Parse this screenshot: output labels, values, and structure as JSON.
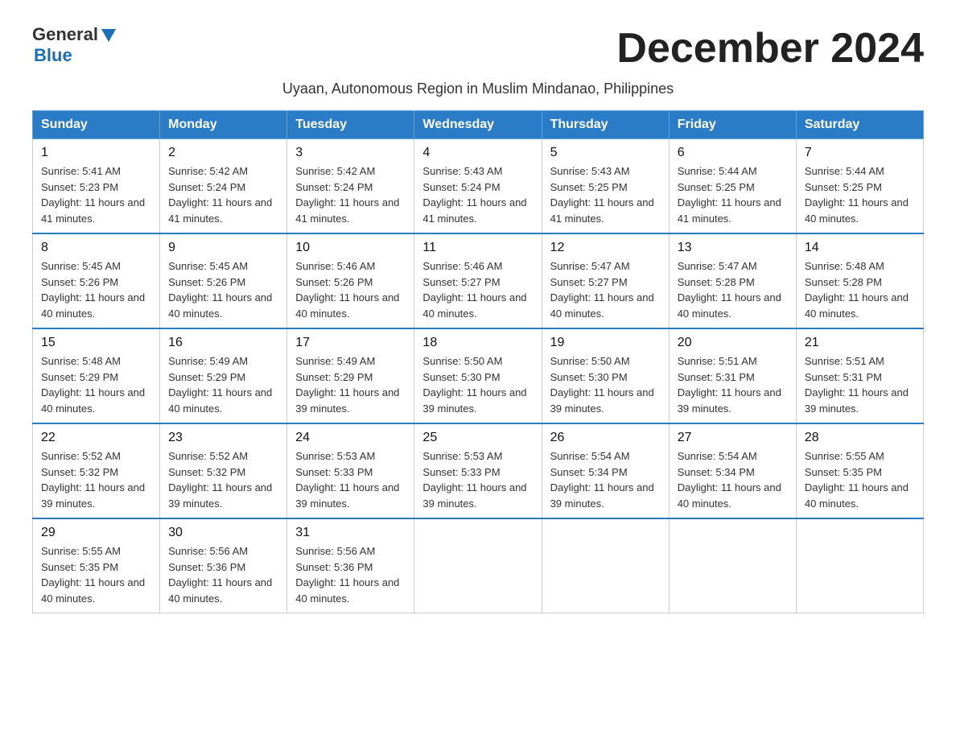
{
  "header": {
    "logo_general": "General",
    "logo_blue": "Blue",
    "month_title": "December 2024",
    "subtitle": "Uyaan, Autonomous Region in Muslim Mindanao, Philippines"
  },
  "weekdays": [
    "Sunday",
    "Monday",
    "Tuesday",
    "Wednesday",
    "Thursday",
    "Friday",
    "Saturday"
  ],
  "weeks": [
    [
      {
        "day": "1",
        "sunrise": "5:41 AM",
        "sunset": "5:23 PM",
        "daylight": "11 hours and 41 minutes."
      },
      {
        "day": "2",
        "sunrise": "5:42 AM",
        "sunset": "5:24 PM",
        "daylight": "11 hours and 41 minutes."
      },
      {
        "day": "3",
        "sunrise": "5:42 AM",
        "sunset": "5:24 PM",
        "daylight": "11 hours and 41 minutes."
      },
      {
        "day": "4",
        "sunrise": "5:43 AM",
        "sunset": "5:24 PM",
        "daylight": "11 hours and 41 minutes."
      },
      {
        "day": "5",
        "sunrise": "5:43 AM",
        "sunset": "5:25 PM",
        "daylight": "11 hours and 41 minutes."
      },
      {
        "day": "6",
        "sunrise": "5:44 AM",
        "sunset": "5:25 PM",
        "daylight": "11 hours and 41 minutes."
      },
      {
        "day": "7",
        "sunrise": "5:44 AM",
        "sunset": "5:25 PM",
        "daylight": "11 hours and 40 minutes."
      }
    ],
    [
      {
        "day": "8",
        "sunrise": "5:45 AM",
        "sunset": "5:26 PM",
        "daylight": "11 hours and 40 minutes."
      },
      {
        "day": "9",
        "sunrise": "5:45 AM",
        "sunset": "5:26 PM",
        "daylight": "11 hours and 40 minutes."
      },
      {
        "day": "10",
        "sunrise": "5:46 AM",
        "sunset": "5:26 PM",
        "daylight": "11 hours and 40 minutes."
      },
      {
        "day": "11",
        "sunrise": "5:46 AM",
        "sunset": "5:27 PM",
        "daylight": "11 hours and 40 minutes."
      },
      {
        "day": "12",
        "sunrise": "5:47 AM",
        "sunset": "5:27 PM",
        "daylight": "11 hours and 40 minutes."
      },
      {
        "day": "13",
        "sunrise": "5:47 AM",
        "sunset": "5:28 PM",
        "daylight": "11 hours and 40 minutes."
      },
      {
        "day": "14",
        "sunrise": "5:48 AM",
        "sunset": "5:28 PM",
        "daylight": "11 hours and 40 minutes."
      }
    ],
    [
      {
        "day": "15",
        "sunrise": "5:48 AM",
        "sunset": "5:29 PM",
        "daylight": "11 hours and 40 minutes."
      },
      {
        "day": "16",
        "sunrise": "5:49 AM",
        "sunset": "5:29 PM",
        "daylight": "11 hours and 40 minutes."
      },
      {
        "day": "17",
        "sunrise": "5:49 AM",
        "sunset": "5:29 PM",
        "daylight": "11 hours and 39 minutes."
      },
      {
        "day": "18",
        "sunrise": "5:50 AM",
        "sunset": "5:30 PM",
        "daylight": "11 hours and 39 minutes."
      },
      {
        "day": "19",
        "sunrise": "5:50 AM",
        "sunset": "5:30 PM",
        "daylight": "11 hours and 39 minutes."
      },
      {
        "day": "20",
        "sunrise": "5:51 AM",
        "sunset": "5:31 PM",
        "daylight": "11 hours and 39 minutes."
      },
      {
        "day": "21",
        "sunrise": "5:51 AM",
        "sunset": "5:31 PM",
        "daylight": "11 hours and 39 minutes."
      }
    ],
    [
      {
        "day": "22",
        "sunrise": "5:52 AM",
        "sunset": "5:32 PM",
        "daylight": "11 hours and 39 minutes."
      },
      {
        "day": "23",
        "sunrise": "5:52 AM",
        "sunset": "5:32 PM",
        "daylight": "11 hours and 39 minutes."
      },
      {
        "day": "24",
        "sunrise": "5:53 AM",
        "sunset": "5:33 PM",
        "daylight": "11 hours and 39 minutes."
      },
      {
        "day": "25",
        "sunrise": "5:53 AM",
        "sunset": "5:33 PM",
        "daylight": "11 hours and 39 minutes."
      },
      {
        "day": "26",
        "sunrise": "5:54 AM",
        "sunset": "5:34 PM",
        "daylight": "11 hours and 39 minutes."
      },
      {
        "day": "27",
        "sunrise": "5:54 AM",
        "sunset": "5:34 PM",
        "daylight": "11 hours and 40 minutes."
      },
      {
        "day": "28",
        "sunrise": "5:55 AM",
        "sunset": "5:35 PM",
        "daylight": "11 hours and 40 minutes."
      }
    ],
    [
      {
        "day": "29",
        "sunrise": "5:55 AM",
        "sunset": "5:35 PM",
        "daylight": "11 hours and 40 minutes."
      },
      {
        "day": "30",
        "sunrise": "5:56 AM",
        "sunset": "5:36 PM",
        "daylight": "11 hours and 40 minutes."
      },
      {
        "day": "31",
        "sunrise": "5:56 AM",
        "sunset": "5:36 PM",
        "daylight": "11 hours and 40 minutes."
      },
      null,
      null,
      null,
      null
    ]
  ]
}
